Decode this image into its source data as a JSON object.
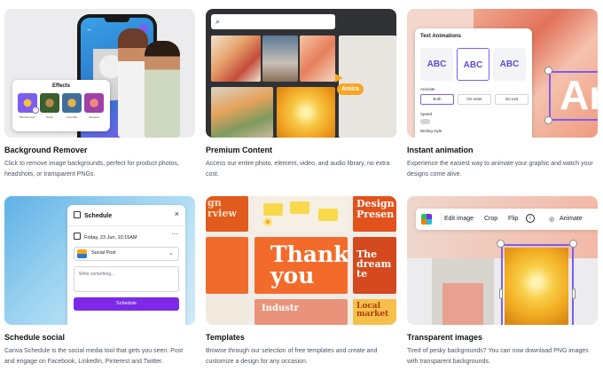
{
  "cards": [
    {
      "title": "Background Remover",
      "description": "Click to remove image backgrounds, perfect for product photos, headshots, or transparent PNGs.",
      "mockup": {
        "panel_title": "Effects",
        "effects": [
          "BG Remover",
          "Photo",
          "Color Mix",
          "Duotone"
        ]
      }
    },
    {
      "title": "Premium Content",
      "description": "Access our entire photo, element, video, and audio library, no extra cost.",
      "mockup": {
        "collaborator": "Amira"
      }
    },
    {
      "title": "Instant animation",
      "description": "Experience the easiest way to animate your graphic and watch your designs come alive.",
      "mockup": {
        "panel_title": "Text Animations",
        "sample_text": "ABC",
        "animate_label": "Animate",
        "animate_options": [
          "Both",
          "On enter",
          "On exit"
        ],
        "speed_label": "Speed",
        "writing_style_label": "Writing style",
        "canvas_letter": "Ar"
      }
    },
    {
      "title": "Schedule social",
      "description": "Canva Schedule is the social media tool that gets you seen. Post and engage on Facebook, LinkedIn, Pinterest and Twitter.",
      "mockup": {
        "panel_title": "Schedule",
        "date_text": "Friday, 23 Jun, 10:15AM",
        "post_type": "Social Post",
        "placeholder": "Write something...",
        "button_label": "Schedule"
      }
    },
    {
      "title": "Templates",
      "description": "Browse through our selection of free templates and create and customize a design for any occasion.",
      "mockup": {
        "texts": [
          "gn\nrview",
          "Design\nPresen",
          "Thank\nyou",
          "The\ndream\nte",
          "Industr",
          "Local\nmarket"
        ]
      }
    },
    {
      "title": "Transparent images",
      "description": "Tired of pesky backgrounds? You can now download PNG images with transparent backgrounds.",
      "mockup": {
        "toolbar": [
          "Edit image",
          "Crop",
          "Flip",
          "Animate"
        ]
      }
    }
  ],
  "colors": {
    "accent": "#7d2ae8",
    "selection": "#7d5df0",
    "badge": "#f5a623"
  }
}
